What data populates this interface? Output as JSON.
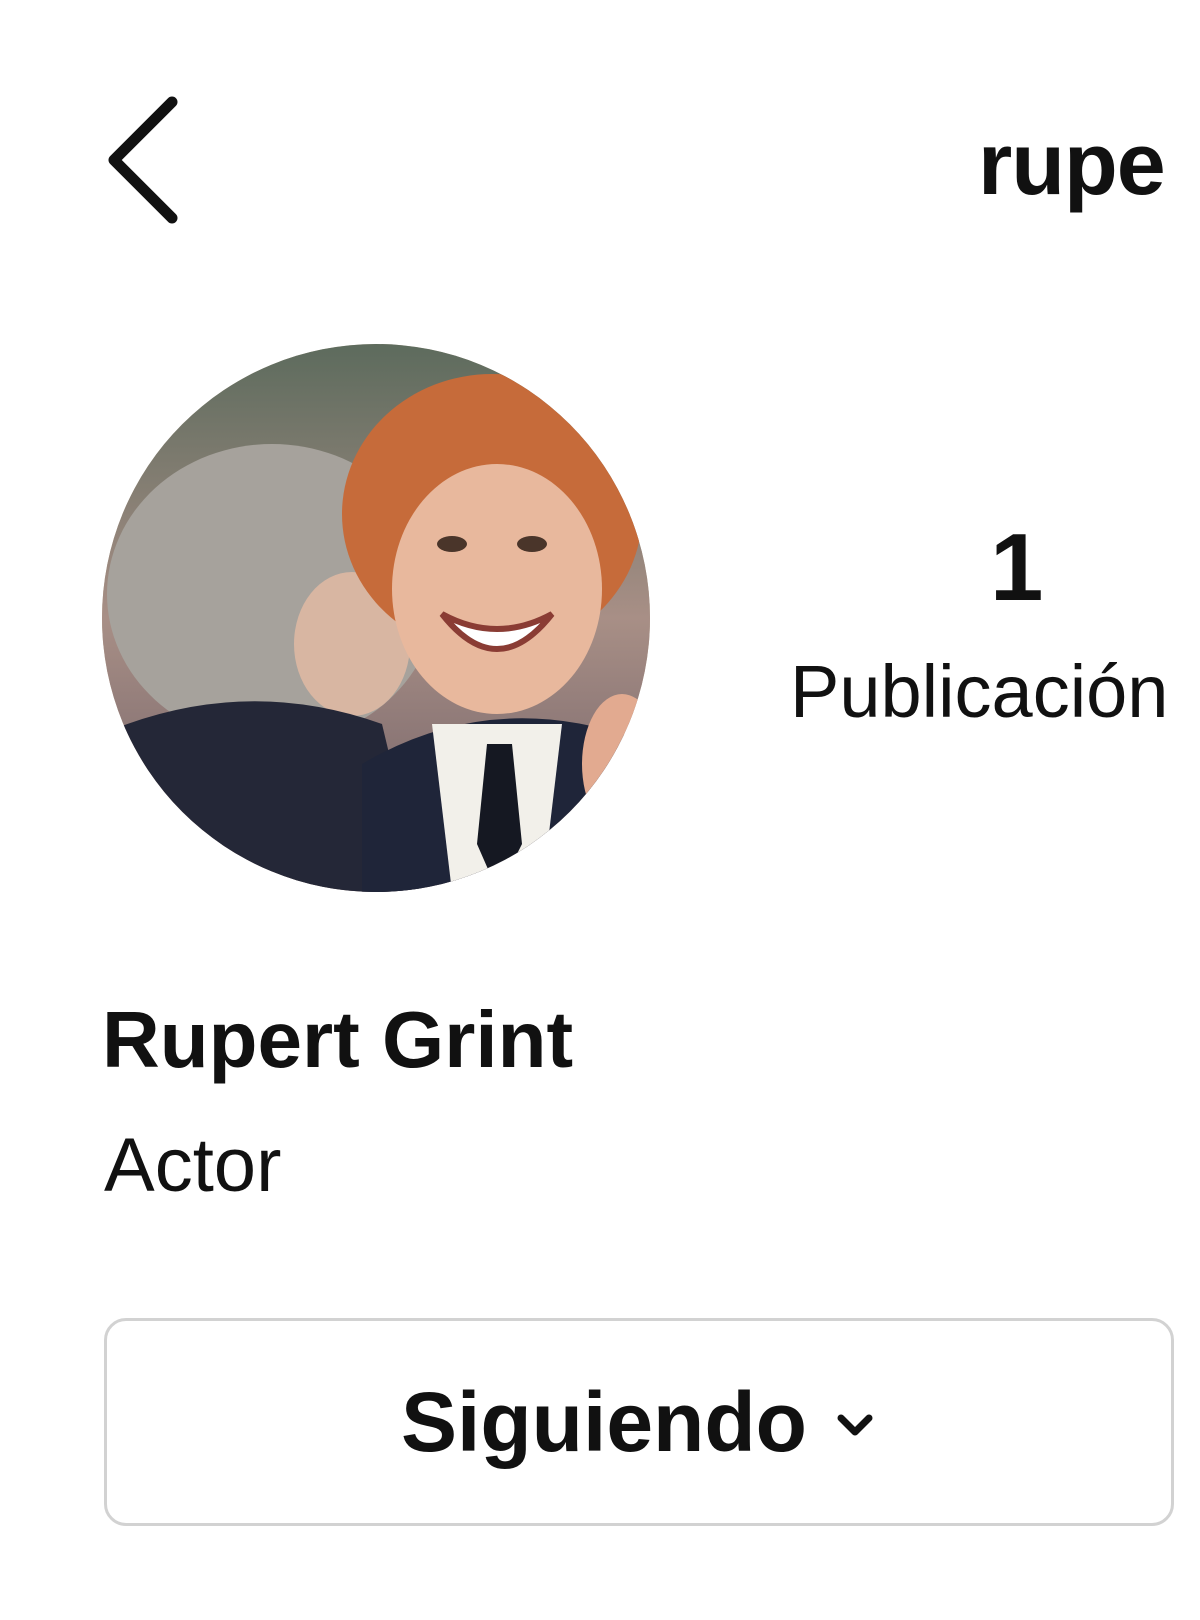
{
  "header": {
    "back_icon": "chevron-left-icon",
    "username": "rupe"
  },
  "profile": {
    "avatar_icon": "profile-photo",
    "stats": {
      "posts_count": "1",
      "posts_label": "Publicación"
    },
    "full_name": "Rupert Grint",
    "bio": "Actor"
  },
  "actions": {
    "follow_label": "Siguiendo",
    "follow_icon": "chevron-down-icon"
  }
}
